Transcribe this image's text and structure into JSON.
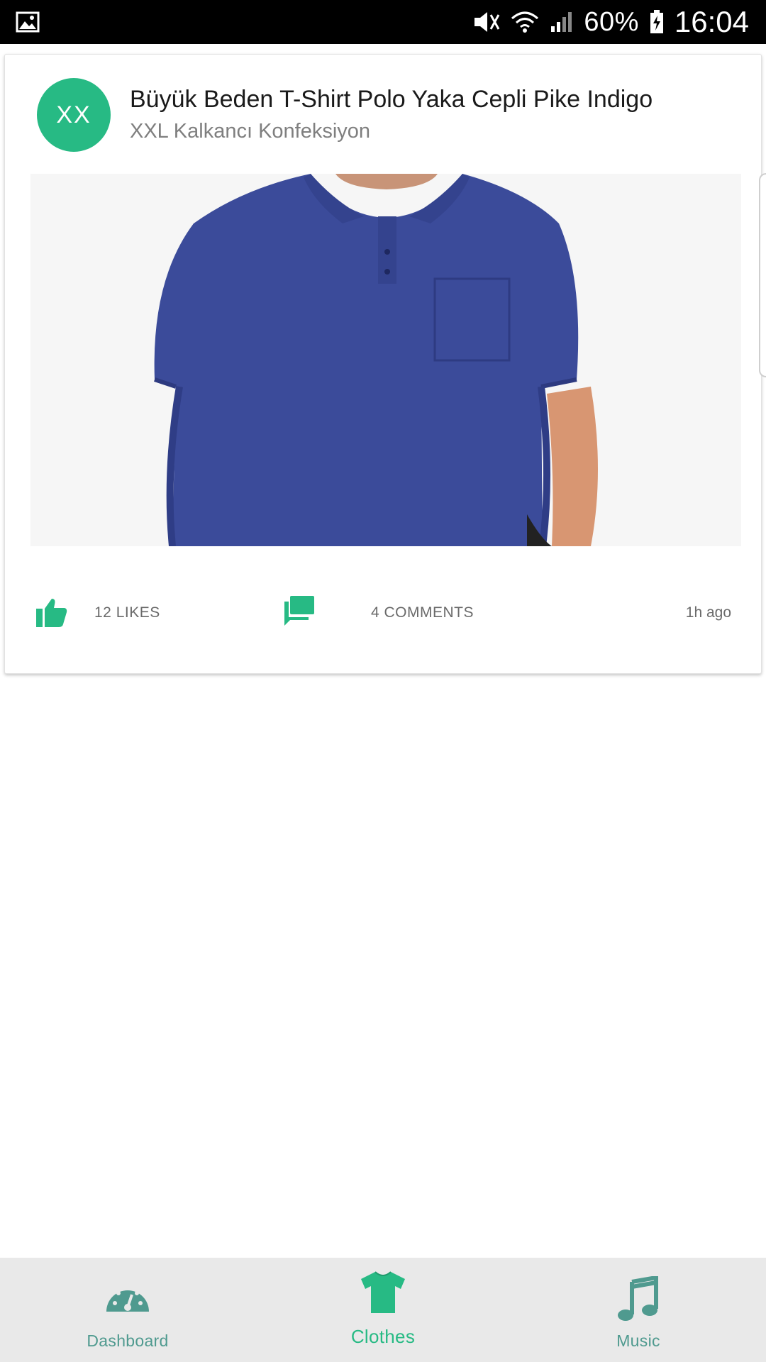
{
  "status_bar": {
    "battery_percent": "60%",
    "time": "16:04",
    "icons": [
      "gallery-icon",
      "mute-icon",
      "wifi-icon",
      "signal-icon",
      "battery-icon"
    ]
  },
  "post": {
    "avatar_initials": "XX",
    "title": "Büyük Beden T-Shirt Polo Yaka Cepli Pike Indigo",
    "subtitle": "XXL Kalkancı Konfeksiyon",
    "likes_label": "12 LIKES",
    "comments_label": "4 COMMENTS",
    "time_ago": "1h ago"
  },
  "bottom_nav": {
    "items": [
      {
        "label": "Dashboard",
        "icon": "dashboard-gauge-icon"
      },
      {
        "label": "Clothes",
        "icon": "tshirt-icon",
        "active": true
      },
      {
        "label": "Music",
        "icon": "music-note-icon"
      }
    ]
  },
  "colors": {
    "accent": "#27ba84",
    "nav_inactive": "#4f9a8f",
    "nav_background": "#e9e9e9",
    "shirt": "#3b4b9a"
  }
}
